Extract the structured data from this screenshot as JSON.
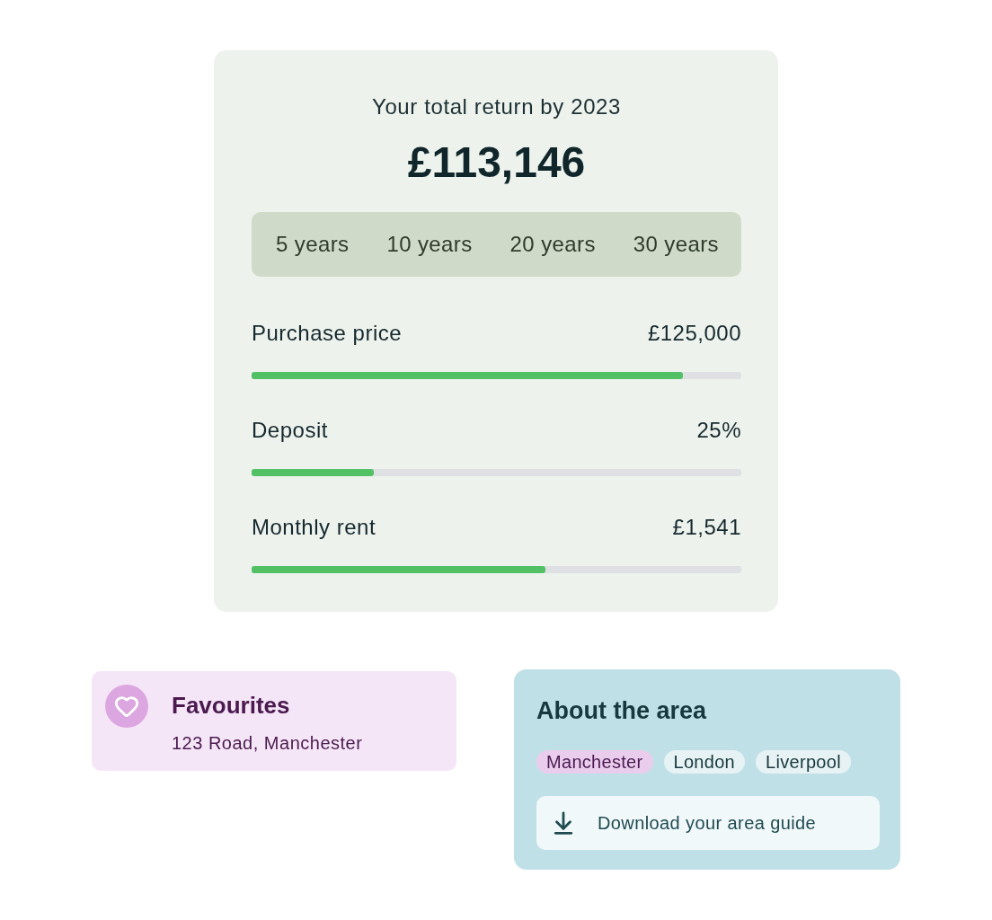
{
  "summary": {
    "title": "Your total return by 2023",
    "total": "£113,146",
    "periods": [
      {
        "label": "5 years",
        "selected": false
      },
      {
        "label": "10 years",
        "selected": false
      },
      {
        "label": "20 years",
        "selected": false
      },
      {
        "label": "30 years",
        "selected": false
      }
    ],
    "sliders": [
      {
        "label": "Purchase price",
        "value": "£125,000",
        "level": 0.88
      },
      {
        "label": "Deposit",
        "value": "25%",
        "level": 0.25
      },
      {
        "label": "Monthly rent",
        "value": "£1,541",
        "level": 0.6
      }
    ]
  },
  "favourites": {
    "title": "Favourites",
    "address": "123 Road, Manchester"
  },
  "area": {
    "title": "About the area",
    "chips": [
      {
        "label": "Manchester",
        "selected": true
      },
      {
        "label": "London",
        "selected": false
      },
      {
        "label": "Liverpool",
        "selected": false
      }
    ],
    "download": {
      "label": "Download your area guide"
    }
  }
}
